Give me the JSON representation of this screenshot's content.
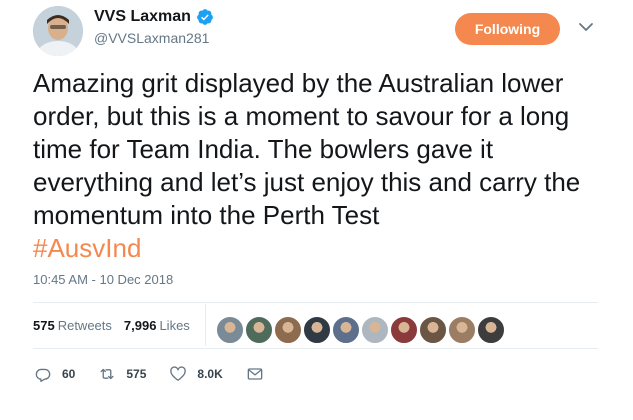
{
  "author": {
    "display_name": "VVS Laxman",
    "handle": "@VVSLaxman281",
    "verified": true,
    "avatar_icon": "profile-photo"
  },
  "follow_button": {
    "label": "Following",
    "color": "#f4884e"
  },
  "menu_icon": "chevron-down-icon",
  "tweet": {
    "text": "Amazing grit displayed by the Australian lower order, but this is a moment to savour for a long time for Team India. The bowlers gave it everything and let’s just enjoy this and carry the momentum into the Perth Test",
    "hashtag": "#AusvInd",
    "timestamp": "10:45 AM - 10 Dec 2018"
  },
  "stats": {
    "retweets_count": "575",
    "retweets_label": "Retweets",
    "likes_count": "7,996",
    "likes_label": "Likes"
  },
  "liker_avatars": [
    "#7a8a96",
    "#4f6b5c",
    "#8c6b4f",
    "#2f3a44",
    "#5c6f8c",
    "#aeb7bf",
    "#8a3a3a",
    "#6b5646",
    "#9b7d63",
    "#3d3d3d"
  ],
  "actions": {
    "reply_count": "60",
    "retweet_count": "575",
    "like_count": "8.0K"
  },
  "colors": {
    "accent": "#f4884e",
    "muted": "#657786",
    "verified": "#1da1f2"
  }
}
